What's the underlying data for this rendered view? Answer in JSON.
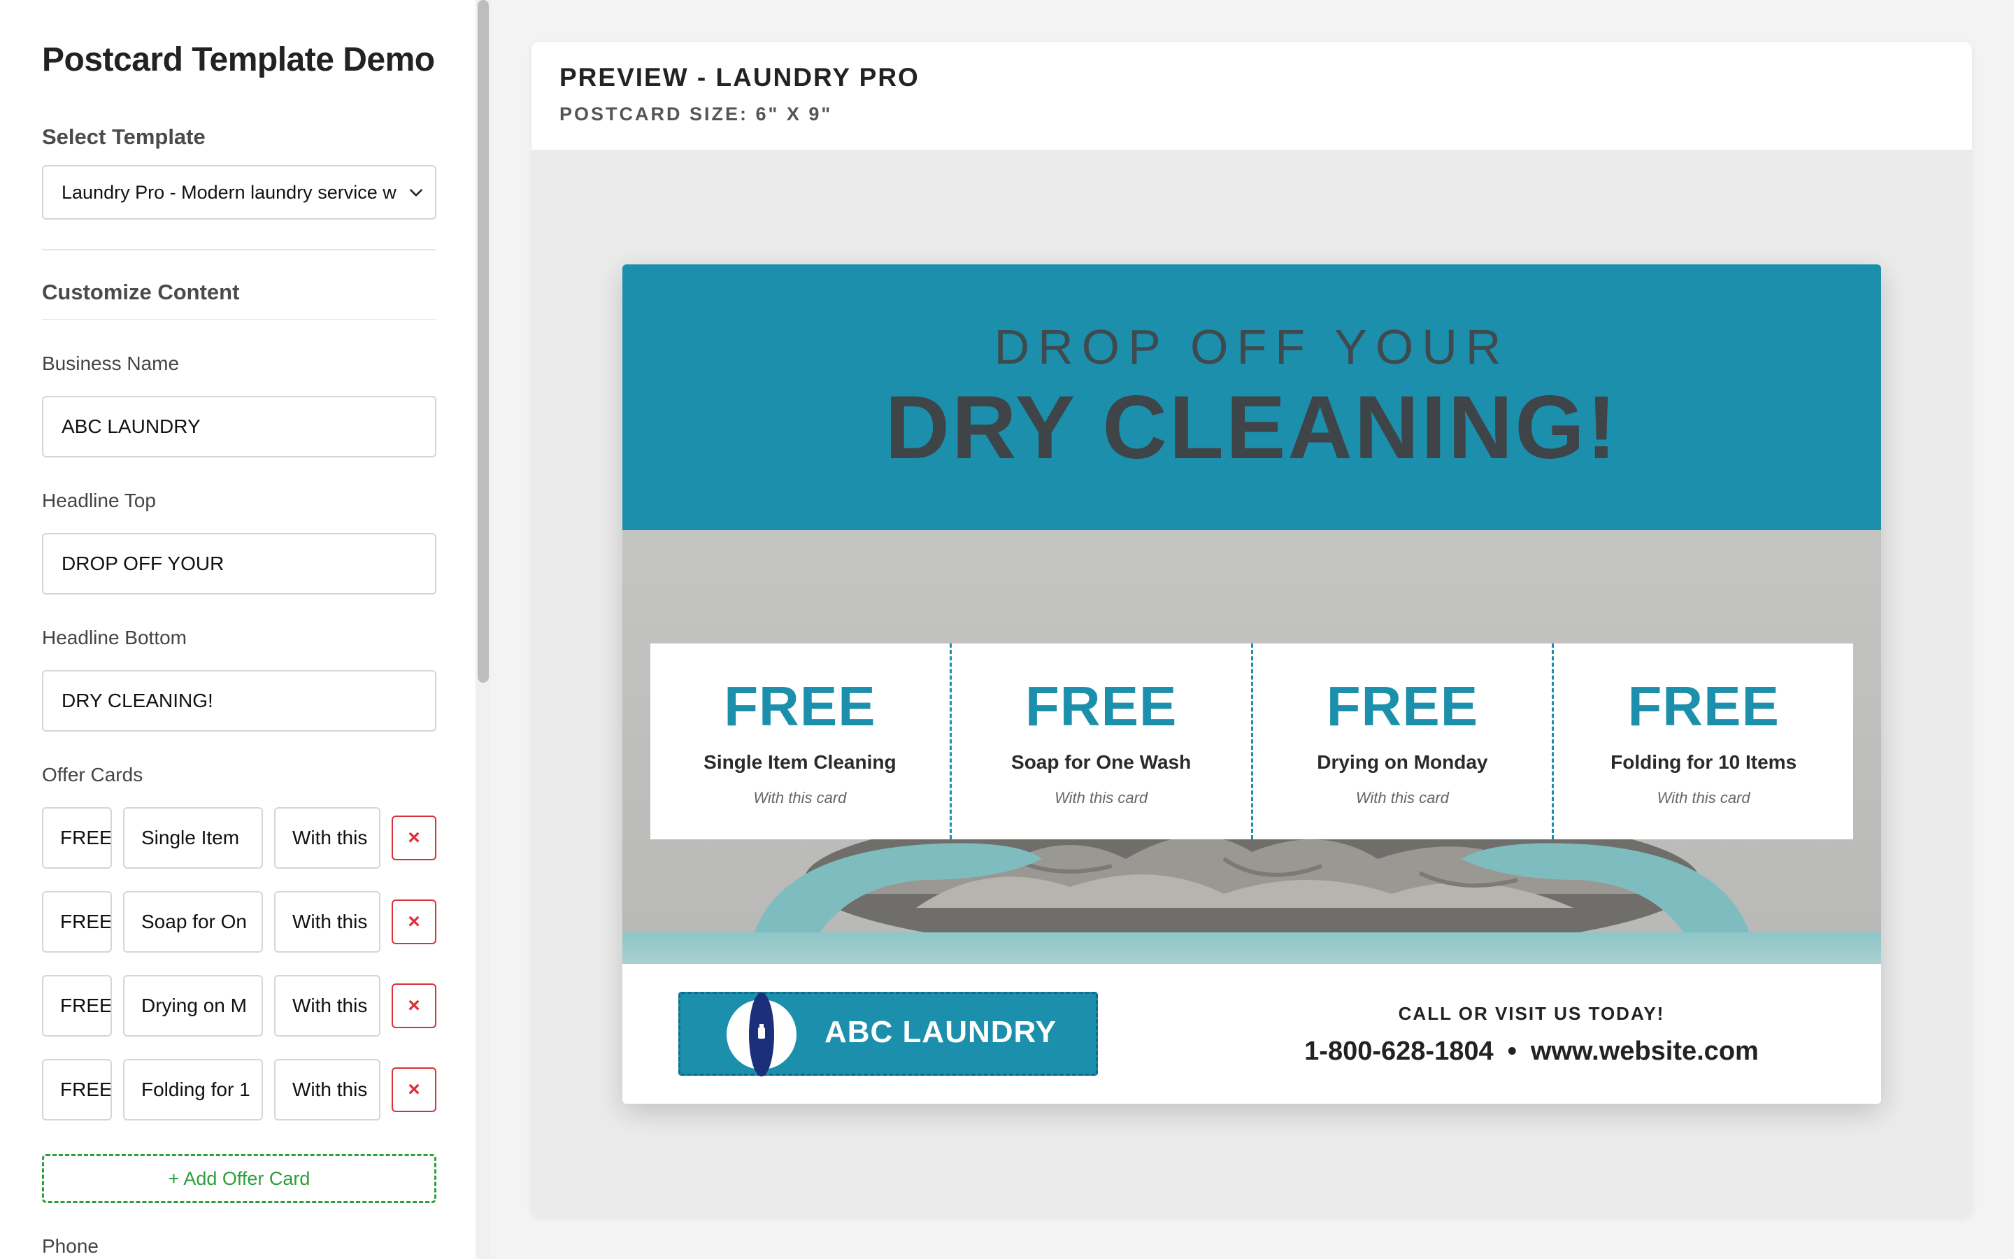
{
  "app": {
    "title": "Postcard Template Demo"
  },
  "sidebar": {
    "select_template_label": "Select Template",
    "template_selected": "Laundry Pro - Modern laundry service w",
    "customize_label": "Customize Content",
    "business_name_label": "Business Name",
    "business_name_value": "ABC LAUNDRY",
    "headline_top_label": "Headline Top",
    "headline_top_value": "DROP OFF YOUR",
    "headline_bottom_label": "Headline Bottom",
    "headline_bottom_value": "DRY CLEANING!",
    "offer_cards_label": "Offer Cards",
    "offer_rows": [
      {
        "free": "FREE",
        "title": "Single Item",
        "sub": "With this",
        "delete": "×"
      },
      {
        "free": "FREE",
        "title": "Soap for On",
        "sub": "With this",
        "delete": "×"
      },
      {
        "free": "FREE",
        "title": "Drying on M",
        "sub": "With this",
        "delete": "×"
      },
      {
        "free": "FREE",
        "title": "Folding for 1",
        "sub": "With this",
        "delete": "×"
      }
    ],
    "add_offer_label": "+ Add Offer Card",
    "phone_label": "Phone"
  },
  "preview": {
    "title": "PREVIEW - LAUNDRY PRO",
    "size": "POSTCARD SIZE: 6\" X 9\""
  },
  "postcard": {
    "accent_color": "#1b8fab",
    "headline_top": "DROP OFF YOUR",
    "headline_bottom": "DRY CLEANING!",
    "offers": [
      {
        "free": "FREE",
        "title": "Single Item Cleaning",
        "sub": "With this card"
      },
      {
        "free": "FREE",
        "title": "Soap for One Wash",
        "sub": "With this card"
      },
      {
        "free": "FREE",
        "title": "Drying on Monday",
        "sub": "With this card"
      },
      {
        "free": "FREE",
        "title": "Folding for 10 Items",
        "sub": "With this card"
      }
    ],
    "business_name": "ABC LAUNDRY",
    "cta": "CALL OR VISIT US TODAY!",
    "phone": "1-800-628-1804",
    "separator": "•",
    "website": "www.website.com",
    "logo_icon": "laundry-logo-icon"
  }
}
